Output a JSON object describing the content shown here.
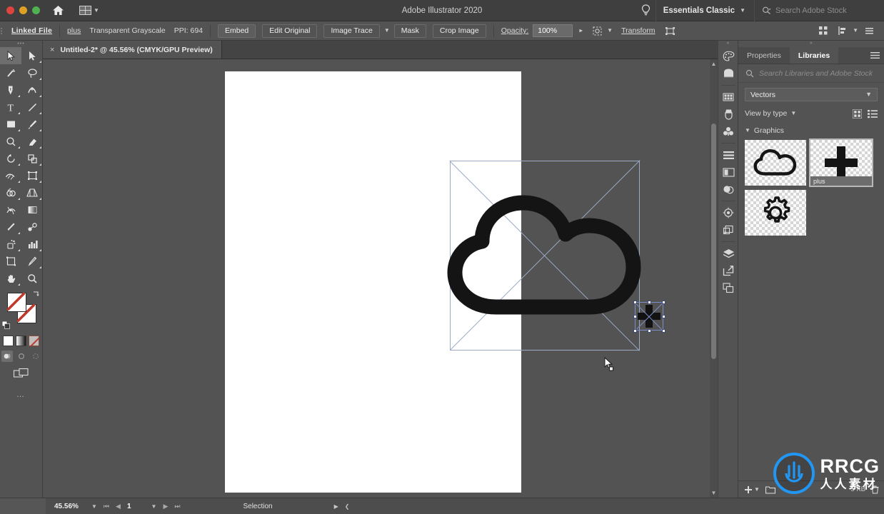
{
  "titlebar": {
    "app_title": "Adobe Illustrator 2020",
    "home_icon": "home-icon",
    "arrange_icon": "arrange-documents-icon",
    "bulb_icon": "discover-bulb-icon",
    "workspace": "Essentials Classic",
    "search_placeholder": "Search Adobe Stock",
    "search_icon": "search-icon"
  },
  "controlbar": {
    "linked_file": "Linked File",
    "file_name": "plus",
    "color_mode": "Transparent Grayscale",
    "ppi": "PPI: 694",
    "embed": "Embed",
    "edit_original": "Edit Original",
    "image_trace": "Image Trace",
    "mask": "Mask",
    "crop_image": "Crop Image",
    "opacity_label": "Opacity:",
    "opacity_value": "100%",
    "transform": "Transform",
    "isolate_icon": "isolate-selected-object-icon",
    "recolor_icon": "recolor-artwork-icon",
    "align_icon": "align-icon",
    "distribute_icon": "distribute-icon",
    "options_icon": "more-options-icon"
  },
  "tabbar": {
    "tab_title": "Untitled-2* @ 45.56% (CMYK/GPU Preview)",
    "close_glyph": "×"
  },
  "toolbar": {
    "grip": "•••",
    "tools": [
      {
        "name": "selection-tool",
        "selected": true
      },
      {
        "name": "direct-selection-tool",
        "selected": false
      },
      {
        "name": "magic-wand-tool",
        "selected": false
      },
      {
        "name": "lasso-tool",
        "selected": false
      },
      {
        "name": "pen-tool",
        "selected": false
      },
      {
        "name": "curvature-tool",
        "selected": false
      },
      {
        "name": "type-tool",
        "selected": false
      },
      {
        "name": "line-segment-tool",
        "selected": false
      },
      {
        "name": "rectangle-tool",
        "selected": false
      },
      {
        "name": "paintbrush-tool",
        "selected": false
      },
      {
        "name": "shaper-tool",
        "selected": false
      },
      {
        "name": "eraser-tool",
        "selected": false
      },
      {
        "name": "rotate-tool",
        "selected": false
      },
      {
        "name": "scale-tool",
        "selected": false
      },
      {
        "name": "width-tool",
        "selected": false
      },
      {
        "name": "free-transform-tool",
        "selected": false
      },
      {
        "name": "shape-builder-tool",
        "selected": false
      },
      {
        "name": "perspective-grid-tool",
        "selected": false
      },
      {
        "name": "mesh-tool",
        "selected": false
      },
      {
        "name": "gradient-tool",
        "selected": false
      },
      {
        "name": "eyedropper-tool",
        "selected": false
      },
      {
        "name": "blend-tool",
        "selected": false
      },
      {
        "name": "symbol-sprayer-tool",
        "selected": false
      },
      {
        "name": "column-graph-tool",
        "selected": false
      },
      {
        "name": "artboard-tool",
        "selected": false
      },
      {
        "name": "slice-tool",
        "selected": false
      },
      {
        "name": "hand-tool",
        "selected": false
      },
      {
        "name": "zoom-tool",
        "selected": false
      }
    ],
    "fill_swatch": "fill-swatch",
    "stroke_swatch": "stroke-swatch-none",
    "swap_icon": "swap-fill-stroke-icon",
    "default_icon": "default-fill-stroke-icon",
    "fill_modes": [
      "color-fill-mode",
      "gradient-fill-mode",
      "none-fill-mode"
    ],
    "draw_modes": [
      "draw-normal-mode",
      "draw-behind-mode",
      "draw-inside-mode"
    ],
    "screen_mode": "change-screen-mode-icon",
    "more_tools": "edit-toolbar-icon"
  },
  "canvas": {
    "artwork_name": "cloud-outline-artwork",
    "placed_graphic": "plus-graphic-selected",
    "cursor": "selection-cursor"
  },
  "dockstrip": {
    "icons": [
      "color-panel-icon",
      "color-guide-panel-icon",
      "swatches-panel-icon",
      "brushes-panel-icon",
      "symbols-panel-icon",
      "paragraph-styles-panel-icon",
      "stroke-panel-icon",
      "transparency-panel-icon",
      "appearance-panel-icon",
      "graphic-styles-panel-icon",
      "layers-panel-icon",
      "asset-export-panel-icon",
      "artboards-panel-icon"
    ]
  },
  "rightpanel": {
    "tabs": [
      {
        "label": "Properties",
        "active": false
      },
      {
        "label": "Libraries",
        "active": true
      }
    ],
    "menu_icon": "panel-menu-icon",
    "search_placeholder": "Search Libraries and Adobe Stock",
    "search_icon": "search-icon",
    "library_select": "Vectors",
    "view_by": "View by type",
    "grid_view_icon": "grid-view-icon",
    "list_view_icon": "list-view-icon",
    "section": "Graphics",
    "section_chevron": "chevron-down-icon",
    "items": [
      {
        "name": "cloud-graphic-thumbnail",
        "label": "",
        "selected": false
      },
      {
        "name": "plus-graphic-thumbnail",
        "label": "plus",
        "selected": true
      },
      {
        "name": "gear-graphic-thumbnail",
        "label": "",
        "selected": false
      }
    ],
    "footer_add_icon": "add-content-icon",
    "footer_folder_icon": "new-library-icon",
    "footer_size": "5 KB"
  },
  "statusbar": {
    "zoom": "45.56%",
    "zoom_chevron": "chevron-down-icon",
    "first_page_icon": "first-artboard-icon",
    "prev_page_icon": "previous-artboard-icon",
    "page": "1",
    "page_chevron": "chevron-down-icon",
    "next_page_icon": "next-artboard-icon",
    "last_page_icon": "last-artboard-icon",
    "tool_status": "Selection",
    "status_arrow": "▶"
  },
  "watermarks": {
    "brand": "RRCG",
    "cn_text": "人人素材",
    "logo_brand": "RRCG",
    "logo_cn": "人人素材"
  },
  "colors": {
    "panel_bg": "#535353",
    "titlebar_bg": "#3f3f3f",
    "accent_blue": "#2196f3",
    "selection_blue": "#7b8ec9",
    "artboard_white": "#ffffff"
  }
}
